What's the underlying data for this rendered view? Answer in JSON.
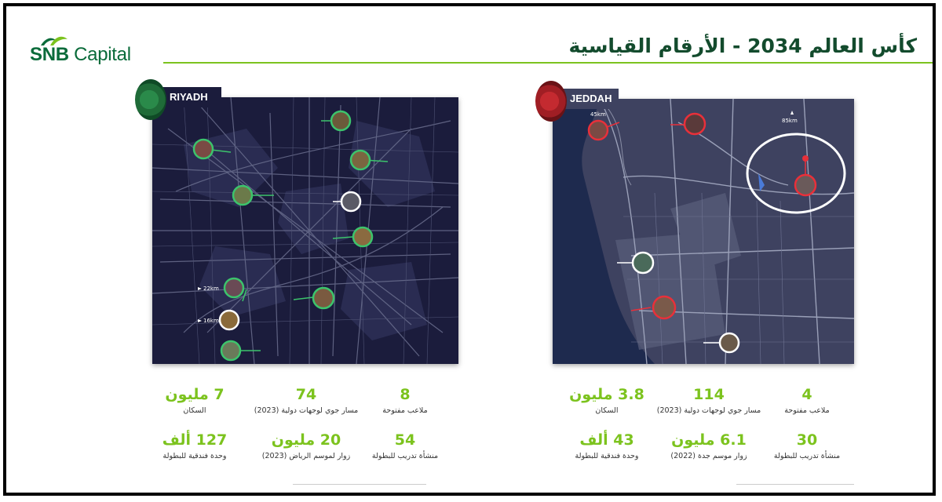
{
  "logo": {
    "brand_bold": "SNB",
    "brand_light": " Capital"
  },
  "title": "كأس العالم 2034 - الأرقام القياسية",
  "colors": {
    "accent_green": "#7cc31e",
    "brand_green": "#0a6b3a",
    "riyadh_pin": "#3cc46c",
    "jeddah_pin": "#e8303a",
    "map_bg_riyadh": "#1b1c3c",
    "map_bg_jeddah": "#3a3e58"
  },
  "riyadh": {
    "tag": "RIYADH",
    "distance_a": "22km",
    "distance_b": "16km",
    "stats": [
      {
        "value": "7 مليون",
        "label": "السكان"
      },
      {
        "value": "74",
        "label": "مسار جوي لوجهات دولية (2023)"
      },
      {
        "value": "8",
        "label": "ملاعب مفتوحة"
      },
      {
        "value": "127 ألف",
        "label": "وحدة فندقية للبطولة"
      },
      {
        "value": "20 مليون",
        "label": "زوار لموسم الرياض (2023)"
      },
      {
        "value": "54",
        "label": "منشأة تدريب للبطولة"
      }
    ]
  },
  "jeddah": {
    "tag": "JEDDAH",
    "distance_a": "45km",
    "distance_b": "85km",
    "stats": [
      {
        "value": "3.8 مليون",
        "label": "السكان"
      },
      {
        "value": "114",
        "label": "مسار جوي لوجهات دولية (2023)"
      },
      {
        "value": "4",
        "label": "ملاعب مفتوحة"
      },
      {
        "value": "43 ألف",
        "label": "وحدة فندقية للبطولة"
      },
      {
        "value": "6.1 مليون",
        "label": "زوار موسم جدة (2022)"
      },
      {
        "value": "30",
        "label": "منشأة تدريب للبطولة"
      }
    ]
  }
}
